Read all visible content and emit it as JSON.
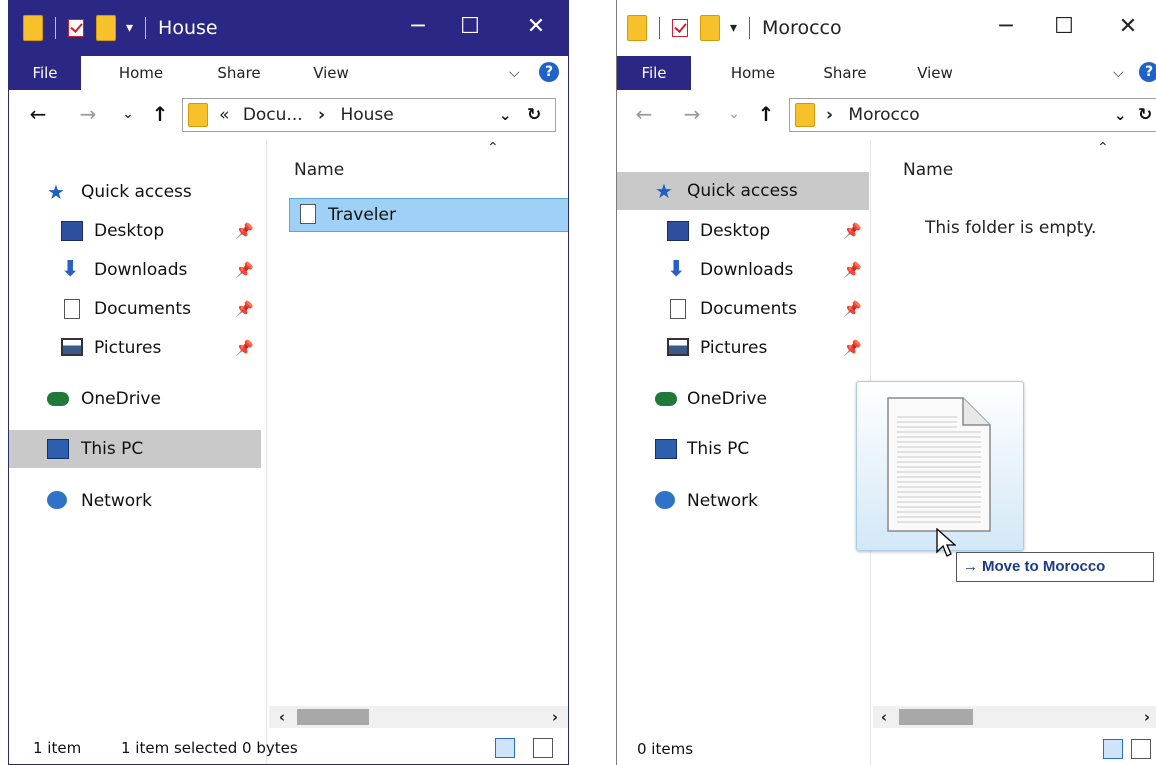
{
  "window_left": {
    "title": "House",
    "ribbon_tabs": [
      "File",
      "Home",
      "Share",
      "View"
    ],
    "address": {
      "overflow": "«",
      "crumb1": "Docu...",
      "separator": "›",
      "crumb2": "House"
    },
    "nav": {
      "quick_access": "Quick access",
      "desktop": "Desktop",
      "downloads": "Downloads",
      "documents": "Documents",
      "pictures": "Pictures",
      "onedrive": "OneDrive",
      "this_pc": "This PC",
      "network": "Network",
      "selected_item": "This PC"
    },
    "column_header": "Name",
    "files": [
      {
        "name": "Traveler",
        "selected": true
      }
    ],
    "status": {
      "count": "1 item",
      "selection": "1 item selected  0 bytes"
    }
  },
  "window_right": {
    "title": "Morocco",
    "ribbon_tabs": [
      "File",
      "Home",
      "Share",
      "View"
    ],
    "address": {
      "separator": "›",
      "crumb1": "Morocco"
    },
    "nav": {
      "quick_access": "Quick access",
      "desktop": "Desktop",
      "downloads": "Downloads",
      "documents": "Documents",
      "pictures": "Pictures",
      "onedrive": "OneDrive",
      "this_pc": "This PC",
      "network": "Network",
      "selected_item": "Quick access"
    },
    "column_header": "Name",
    "empty_message": "This folder is empty.",
    "status": {
      "count": "0 items"
    }
  },
  "drag": {
    "tooltip": "Move to Morocco",
    "icon": "document-icon"
  },
  "colors": {
    "title_accent": "#2b2784",
    "selection": "#9fd0f5",
    "help": "#1f62c8"
  }
}
